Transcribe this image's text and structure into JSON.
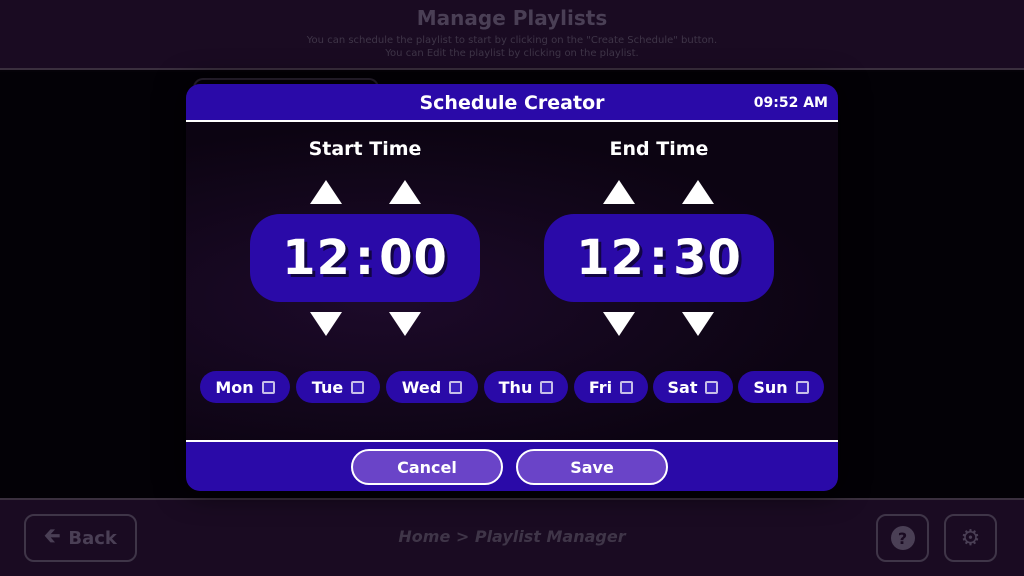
{
  "background": {
    "title": "Manage Playlists",
    "subtitle_line1": "You can schedule the playlist to start by clicking on the \"Create Schedule\" button.",
    "subtitle_line2": "You can Edit the playlist by clicking on the playlist.",
    "back_label": "Back",
    "breadcrumb": "Home > Playlist Manager",
    "help_icon": "question-mark-icon",
    "settings_icon": "gear-icon"
  },
  "modal": {
    "title": "Schedule Creator",
    "clock": "09:52 AM",
    "start": {
      "label": "Start Time",
      "hour": "12",
      "minute": "00",
      "separator": ":"
    },
    "end": {
      "label": "End Time",
      "hour": "12",
      "minute": "30",
      "separator": ":"
    },
    "days": [
      {
        "label": "Mon",
        "checked": false
      },
      {
        "label": "Tue",
        "checked": false
      },
      {
        "label": "Wed",
        "checked": false
      },
      {
        "label": "Thu",
        "checked": false
      },
      {
        "label": "Fri",
        "checked": false
      },
      {
        "label": "Sat",
        "checked": false
      },
      {
        "label": "Sun",
        "checked": false
      }
    ],
    "cancel_label": "Cancel",
    "save_label": "Save"
  },
  "colors": {
    "modal_accent": "#2a0aa8",
    "button_fill": "#6a44c8",
    "background_dim": "#1a0b22"
  }
}
